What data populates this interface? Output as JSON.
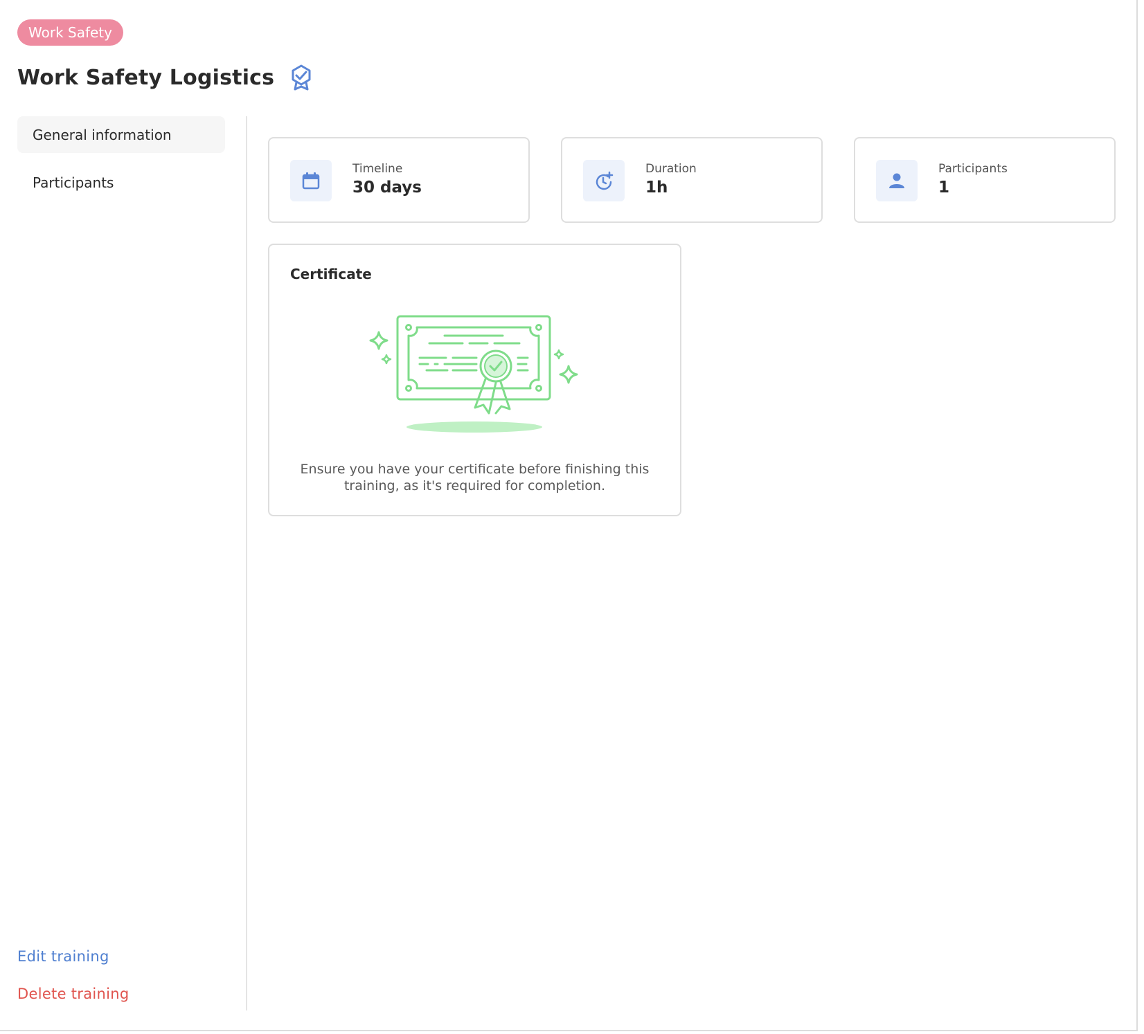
{
  "header": {
    "tag": "Work Safety",
    "title": "Work Safety Logistics",
    "title_icon": "certified-badge-icon"
  },
  "sidebar": {
    "items": [
      {
        "label": "General information",
        "active": true
      },
      {
        "label": "Participants",
        "active": false
      }
    ],
    "actions": {
      "edit": "Edit training",
      "delete": "Delete training"
    }
  },
  "stats": [
    {
      "label": "Timeline",
      "value": "30 days",
      "icon": "calendar-icon"
    },
    {
      "label": "Duration",
      "value": "1h",
      "icon": "clock-plus-icon"
    },
    {
      "label": "Participants",
      "value": "1",
      "icon": "person-icon"
    }
  ],
  "certificate": {
    "title": "Certificate",
    "description": "Ensure you have your certificate before finishing this training, as it's required for completion.",
    "illustration": "certificate-illustration"
  },
  "colors": {
    "tag_bg": "#ee8ba0",
    "accent_blue": "#4f7fd0",
    "danger_red": "#e0554f",
    "cert_green": "#7fdc8a",
    "icon_bg": "#edf2fb"
  }
}
